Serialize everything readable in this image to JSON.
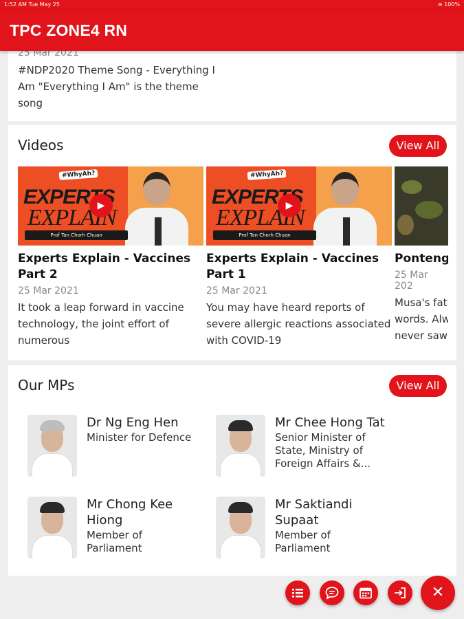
{
  "status_bar": {
    "time": "1:52 AM",
    "day": "Tue May 25",
    "battery": "100%"
  },
  "app": {
    "title": "TPC ZONE4 RN",
    "accent": "#e0141a"
  },
  "news": {
    "date": "25 Mar 2021",
    "description": "#NDP2020 Theme Song - Everything I Am \"Everything I Am\" is the theme song"
  },
  "videos": {
    "title": "Videos",
    "view_all": "View All",
    "items": [
      {
        "title_line1": "Experts Explain - Vaccines",
        "title_line2": "Part 2",
        "date": "25 Mar 2021",
        "desc": [
          "It took a leap forward in vaccine",
          "technology, the joint effort of",
          "numerous"
        ],
        "thumb_badge": "#WhyAh?",
        "thumb_line1": "EXPERTS",
        "thumb_line2": "EXPLAIN",
        "thumb_caption": "Prof Tan Chorh Chuan"
      },
      {
        "title_line1": "Experts Explain - Vaccines",
        "title_line2": "Part 1",
        "date": "25 Mar 2021",
        "desc": [
          "You may have heard reports of",
          "severe allergic reactions associated",
          "with COVID-19"
        ],
        "thumb_badge": "#WhyAh?",
        "thumb_line1": "EXPERTS",
        "thumb_line2": "EXPLAIN",
        "thumb_caption": "Prof Tan Chorh Chuan"
      },
      {
        "title_line1": "Ponteng|",
        "date": "25 Mar 202",
        "desc": [
          "Musa's fatl",
          "words. Alw",
          "never saw"
        ]
      }
    ]
  },
  "mps": {
    "title": "Our MPs",
    "view_all": "View All",
    "items": [
      {
        "name": "Dr Ng Eng Hen",
        "role": "Minister for Defence"
      },
      {
        "name": "Mr Chee Hong Tat",
        "role": "Senior Minister of State, Ministry of Foreign Affairs &..."
      },
      {
        "name": "Mr Chong Kee Hiong",
        "role": "Member of Parliament"
      },
      {
        "name": "Mr Saktiandi Supaat",
        "role": "Member of Parliament"
      }
    ]
  },
  "fab_icons": [
    "list-icon",
    "chat-icon",
    "calendar-icon",
    "login-icon",
    "close-icon"
  ],
  "fab_close_glyph": "✕"
}
